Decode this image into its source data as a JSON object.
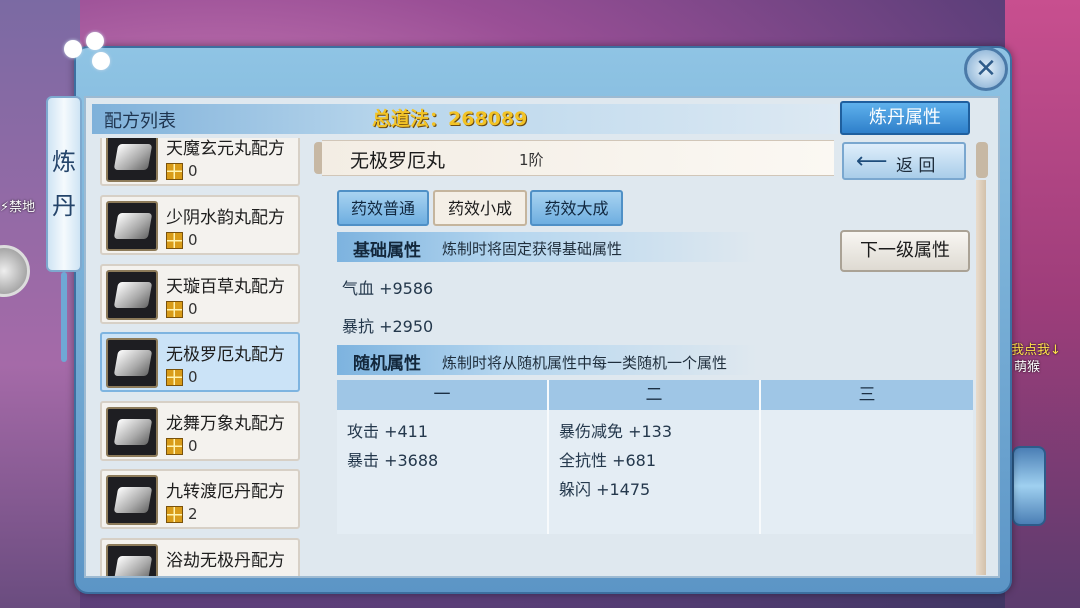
{
  "side": {
    "left_label": "⚡禁地",
    "right_line1": "点我点我↓",
    "right_line2": "萌猴"
  },
  "vertical_tab": {
    "char1": "炼",
    "char2": "丹"
  },
  "header": {
    "list_title": "配方列表",
    "total_law": "总道法：268089",
    "alchemy_attr_button": "炼丹属性",
    "close_glyph": "✕"
  },
  "recipes": [
    {
      "name": "天魔玄元丸配方",
      "count": "0"
    },
    {
      "name": "少阴水韵丸配方",
      "count": "0"
    },
    {
      "name": "天璇百草丸配方",
      "count": "0"
    },
    {
      "name": "无极罗厄丸配方",
      "count": "0"
    },
    {
      "name": "龙舞万象丸配方",
      "count": "0"
    },
    {
      "name": "九转渡厄丹配方",
      "count": "2"
    },
    {
      "name": "浴劫无极丹配方",
      "count": ""
    }
  ],
  "detail": {
    "pill_name": "无极罗厄丸",
    "tier": "1阶",
    "back_button": "返 回",
    "back_arrow": "⟵",
    "tabs": [
      "药效普通",
      "药效小成",
      "药效大成"
    ],
    "basic": {
      "title": "基础属性",
      "desc": "炼制时将固定获得基础属性",
      "stats": [
        "气血 +9586",
        "暴抗 +2950"
      ]
    },
    "next_level_button": "下一级属性",
    "random": {
      "title": "随机属性",
      "desc": "炼制时将从随机属性中每一类随机一个属性",
      "columns": [
        {
          "head": "一",
          "stats": [
            "攻击 +411",
            "暴击 +3688"
          ]
        },
        {
          "head": "二",
          "stats": [
            "暴伤减免 +133",
            "全抗性 +681",
            "躲闪 +1475"
          ]
        },
        {
          "head": "三",
          "stats": []
        }
      ]
    }
  }
}
